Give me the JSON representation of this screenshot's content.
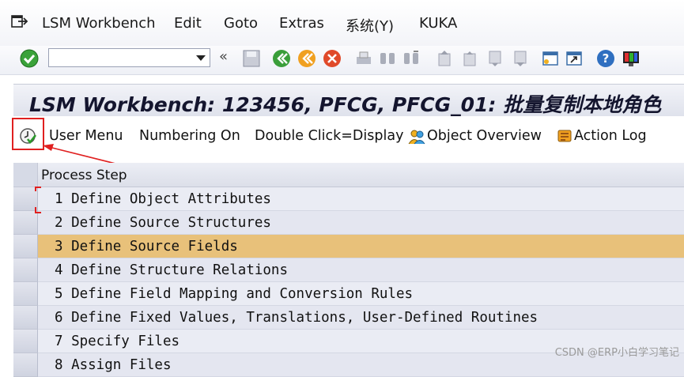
{
  "menubar": {
    "items": [
      "LSM Workbench",
      "Edit",
      "Goto",
      "Extras",
      "系统(Y)",
      "KUKA"
    ]
  },
  "toolbar": {
    "command_field_value": "",
    "icons": [
      "enter-check-icon",
      "command-dropdown-icon",
      "collapse-icon",
      "save-icon",
      "back-icon",
      "exit-icon",
      "cancel-icon",
      "print-icon",
      "find-icon",
      "find-next-icon",
      "first-page-icon",
      "previous-page-icon",
      "next-page-icon",
      "last-page-icon",
      "create-session-icon",
      "generate-shortcut-icon",
      "help-icon",
      "customize-layout-icon"
    ]
  },
  "title": "LSM Workbench: 123456, PFCG, PFCG_01: 批量复制本地角色",
  "app_toolbar": {
    "execute_icon": "execute-clock-check-icon",
    "user_menu": "User Menu",
    "numbering": "Numbering On",
    "double_click": "Double Click=Display",
    "object_overview": "Object Overview",
    "action_log": "Action Log"
  },
  "table": {
    "header": "Process Step",
    "rows": [
      {
        "text": "1 Define Object Attributes",
        "selected": false
      },
      {
        "text": "2 Define Source Structures",
        "selected": false
      },
      {
        "text": "3 Define Source Fields",
        "selected": true
      },
      {
        "text": "4 Define Structure Relations",
        "selected": false
      },
      {
        "text": "5 Define Field Mapping and Conversion Rules",
        "selected": false
      },
      {
        "text": "6 Define Fixed Values, Translations, User-Defined Routines",
        "selected": false
      },
      {
        "text": "7 Specify Files",
        "selected": false
      },
      {
        "text": "8 Assign Files",
        "selected": false
      }
    ]
  },
  "watermark": "CSDN @ERP小白学习笔记",
  "colors": {
    "selected_row": "#e8c17a",
    "annotation_red": "#e02020",
    "title_text": "#14152e"
  }
}
